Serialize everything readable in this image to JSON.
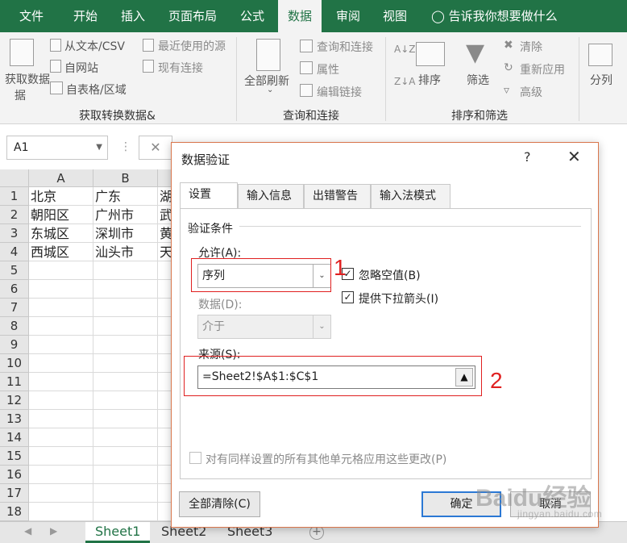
{
  "ribbon_tabs": [
    "文件",
    "开始",
    "插入",
    "页面布局",
    "公式",
    "数据",
    "审阅",
    "视图"
  ],
  "active_tab": "数据",
  "tell_me": "告诉我你想要做什么",
  "ribbon": {
    "get_data": "获取数据",
    "get_data_line2": "据",
    "from_text": "从文本/CSV",
    "from_web": "自网站",
    "from_table": "自表格/区域",
    "recent_sources": "最近使用的源",
    "existing_connections": "现有连接",
    "group_get_transform": "获取转换数据&",
    "refresh_all": "全部刷新",
    "queries_connections": "查询和连接",
    "properties": "属性",
    "edit_links": "编辑链接",
    "group_queries": "查询和连接",
    "sort": "排序",
    "filter": "筛选",
    "clear": "清除",
    "reapply": "重新应用",
    "advanced": "高级",
    "group_sort_filter": "排序和筛选",
    "text_to_columns": "分列"
  },
  "name_box": "A1",
  "fx": "fx",
  "columns": [
    "A",
    "B"
  ],
  "rows": [
    "1",
    "2",
    "3",
    "4",
    "5",
    "6",
    "7",
    "8",
    "9",
    "10",
    "11",
    "12",
    "13",
    "14",
    "15",
    "16",
    "17",
    "18"
  ],
  "cells": {
    "A": [
      "北京",
      "朝阳区",
      "东城区",
      "西城区"
    ],
    "B": [
      "广东",
      "广州市",
      "深圳市",
      "汕头市"
    ],
    "C": [
      "湖",
      "武",
      "黄",
      "天"
    ]
  },
  "sheets": [
    "Sheet1",
    "Sheet2",
    "Sheet3"
  ],
  "active_sheet": "Sheet1",
  "dialog": {
    "title": "数据验证",
    "help": "?",
    "tabs": [
      "设置",
      "输入信息",
      "出错警告",
      "输入法模式"
    ],
    "active_tab": "设置",
    "section": "验证条件",
    "allow_label": "允许(A):",
    "allow_value": "序列",
    "ignore_blank_label": "忽略空值(B)",
    "ignore_blank_checked": true,
    "dropdown_label": "提供下拉箭头(I)",
    "dropdown_checked": true,
    "data_label": "数据(D):",
    "data_value": "介于",
    "source_label": "来源(S):",
    "source_value": "=Sheet2!$A$1:$C$1",
    "apply_all_label": "对有同样设置的所有其他单元格应用这些更改(P)",
    "apply_all_checked": false,
    "clear_all": "全部清除(C)",
    "ok": "确定",
    "cancel": "取消"
  },
  "annotations": [
    "1",
    "2"
  ],
  "watermark": "Baidu经验",
  "watermark_sub": "jingyan.baidu.com",
  "colors": {
    "accent": "#217346",
    "highlight": "#e02020",
    "dialog_border": "#d9764c"
  }
}
